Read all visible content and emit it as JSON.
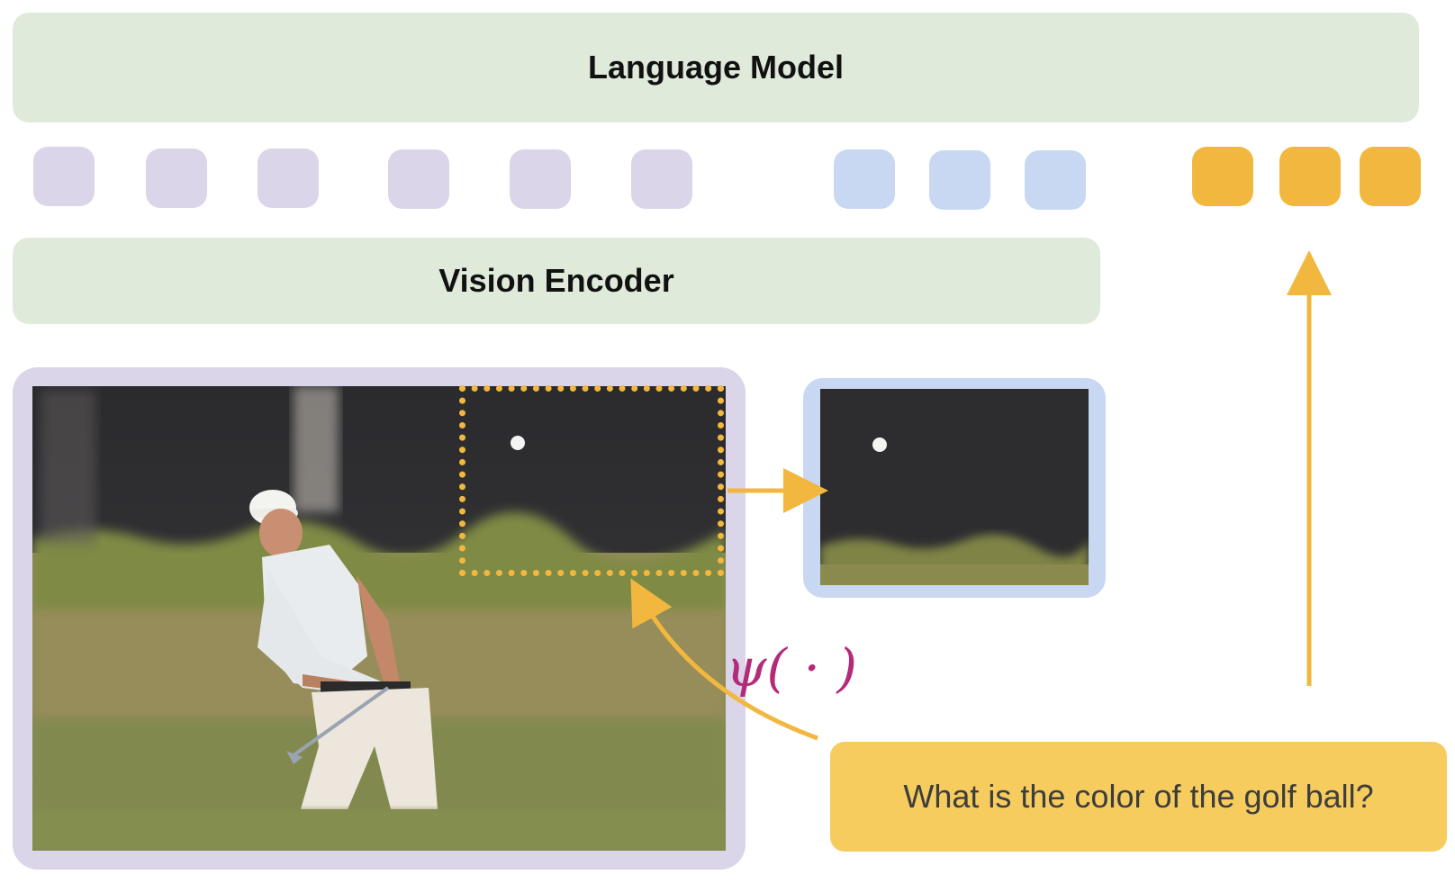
{
  "language_model": {
    "label": "Language Model"
  },
  "vision_encoder": {
    "label": "Vision Encoder"
  },
  "tokens": {
    "image_count": 6,
    "crop_count": 3,
    "text_count": 3
  },
  "colors": {
    "model_fill": "#dfeadb",
    "image_token": "#dad5e8",
    "crop_token": "#c9d8f2",
    "text_token": "#f2b73f",
    "arrow": "#f2b73f",
    "question_fill": "#f6cc5f",
    "psi": "#b42b7a"
  },
  "function_label": {
    "symbol": "ψ( · )"
  },
  "question": {
    "text": "What is the color of the golf ball?"
  },
  "images": {
    "full_image": "golf-scene-image",
    "cropped_region": "golf-ball-crop-image"
  }
}
